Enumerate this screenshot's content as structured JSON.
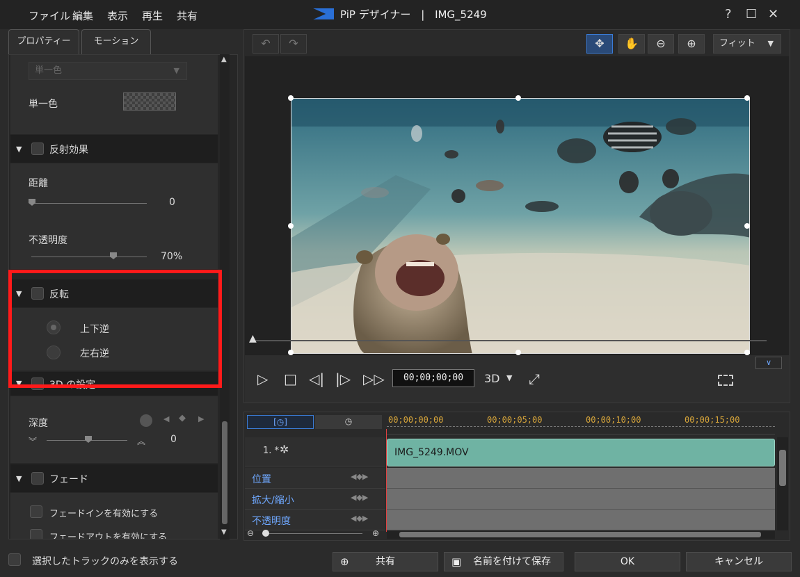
{
  "menu": [
    "ファイル",
    "編集",
    "表示",
    "再生",
    "共有"
  ],
  "app": {
    "name": "PiP デザイナー",
    "separator": "|",
    "file": "IMG_5249"
  },
  "window_buttons": {
    "help": "?",
    "maximize": "☐",
    "close": "✕"
  },
  "tabs": {
    "properties": "プロパティー",
    "motion": "モーション"
  },
  "properties": {
    "fill_type_dropdown": "単一色",
    "solid_color_label": "単一色",
    "reflection": {
      "title": "反射効果",
      "distance_label": "距離",
      "distance_value": "0",
      "distance": 0,
      "opacity_label": "不透明度",
      "opacity_value": "70%",
      "opacity": 0.7
    },
    "flip": {
      "title": "反転",
      "option_vertical": "上下逆",
      "option_horizontal": "左右逆"
    },
    "three_d": {
      "title": "3D の設定",
      "depth_label": "深度",
      "depth_value": "0"
    },
    "fade": {
      "title": "フェード",
      "fade_in": "フェードインを有効にする",
      "fade_out": "フェードアウトを有効にする"
    }
  },
  "preview": {
    "zoom_select": "フィット",
    "timecode": "00;00;00;00",
    "mode_3d": "3D"
  },
  "timeline": {
    "ruler": [
      "00;00;00;00",
      "00;00;05;00",
      "00;00;10;00",
      "00;00;15;00"
    ],
    "track_label": "1. *",
    "clip_name": "IMG_5249.MOV",
    "keyframe_rows": [
      "位置",
      "拡大/縮小",
      "不透明度"
    ]
  },
  "bottom": {
    "only_selected": "選択したトラックのみを表示する",
    "share": "共有",
    "save_as": "名前を付けて保存",
    "ok": "OK",
    "cancel": "キャンセル"
  },
  "colors": {
    "accent": "#3a7bd5",
    "highlight": "#ff1a1a",
    "clip": "#6fb3a3",
    "ruler": "#d7a53a"
  }
}
